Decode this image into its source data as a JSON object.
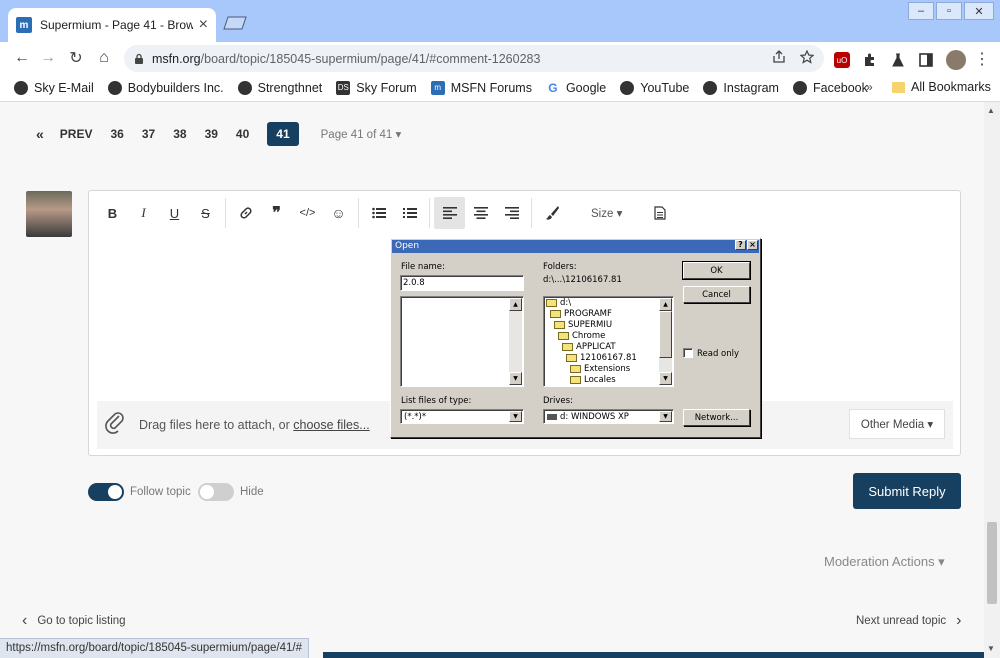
{
  "window": {
    "tab_title": "Supermium - Page 41 - Brow",
    "tab_favicon": "m",
    "tab_close": "×",
    "min_btn": "–",
    "max_btn": "▫",
    "close_btn": "✕"
  },
  "toolbar": {
    "back": "←",
    "forward": "→",
    "reload": "↻",
    "home": "⌂",
    "url_host": "msfn.org",
    "url_path": "/board/topic/185045-supermium/page/41/#comment-1260283",
    "menu": "⋮"
  },
  "bookmarks": [
    {
      "label": "Sky E-Mail",
      "icon": "globe-icon"
    },
    {
      "label": "Bodybuilders Inc.",
      "icon": "globe-icon"
    },
    {
      "label": "Strengthnet",
      "icon": "globe-icon"
    },
    {
      "label": "Sky Forum",
      "icon": "ds-icon"
    },
    {
      "label": "MSFN Forums",
      "icon": "msfn-icon"
    },
    {
      "label": "Google",
      "icon": "google-icon"
    },
    {
      "label": "YouTube",
      "icon": "globe-icon"
    },
    {
      "label": "Instagram",
      "icon": "globe-icon"
    },
    {
      "label": "Facebook",
      "icon": "globe-icon"
    }
  ],
  "bookmarks_more": "»",
  "all_bookmarks": "All Bookmarks",
  "pagination": {
    "first": "«",
    "prev": "PREV",
    "pages": [
      "36",
      "37",
      "38",
      "39",
      "40"
    ],
    "current": "41",
    "page_of": "Page 41 of 41 ▾"
  },
  "editor": {
    "size_label": "Size ▾",
    "attach_text": "Drag files here to attach, or ",
    "attach_link": "choose files...",
    "other_media": "Other Media ▾"
  },
  "follow": {
    "follow_label": "Follow topic",
    "hide_label": "Hide"
  },
  "submit_label": "Submit Reply",
  "moderation_label": "Moderation Actions ▾",
  "go_to_listing": "Go to topic listing",
  "next_unread": "Next unread topic",
  "status_url": "https://msfn.org/board/topic/185045-supermium/page/41/#",
  "dialog": {
    "title": "Open",
    "help_btn": "?",
    "close_btn": "×",
    "file_name_label": "File name:",
    "file_name_value": "2.0.8",
    "folders_label": "Folders:",
    "folders_path": "d:\\...\\12106167.81",
    "tree": [
      "d:\\",
      "PROGRAMF",
      "SUPERMIU",
      "Chrome",
      "APPLICAT",
      "12106167.81",
      "Extensions",
      "Locales"
    ],
    "ok_label": "OK",
    "cancel_label": "Cancel",
    "read_only_label": "Read only",
    "list_type_label": "List files of type:",
    "list_type_value": "(*.*)*",
    "drives_label": "Drives:",
    "drives_value": "d: WINDOWS XP",
    "network_label": "Network..."
  }
}
